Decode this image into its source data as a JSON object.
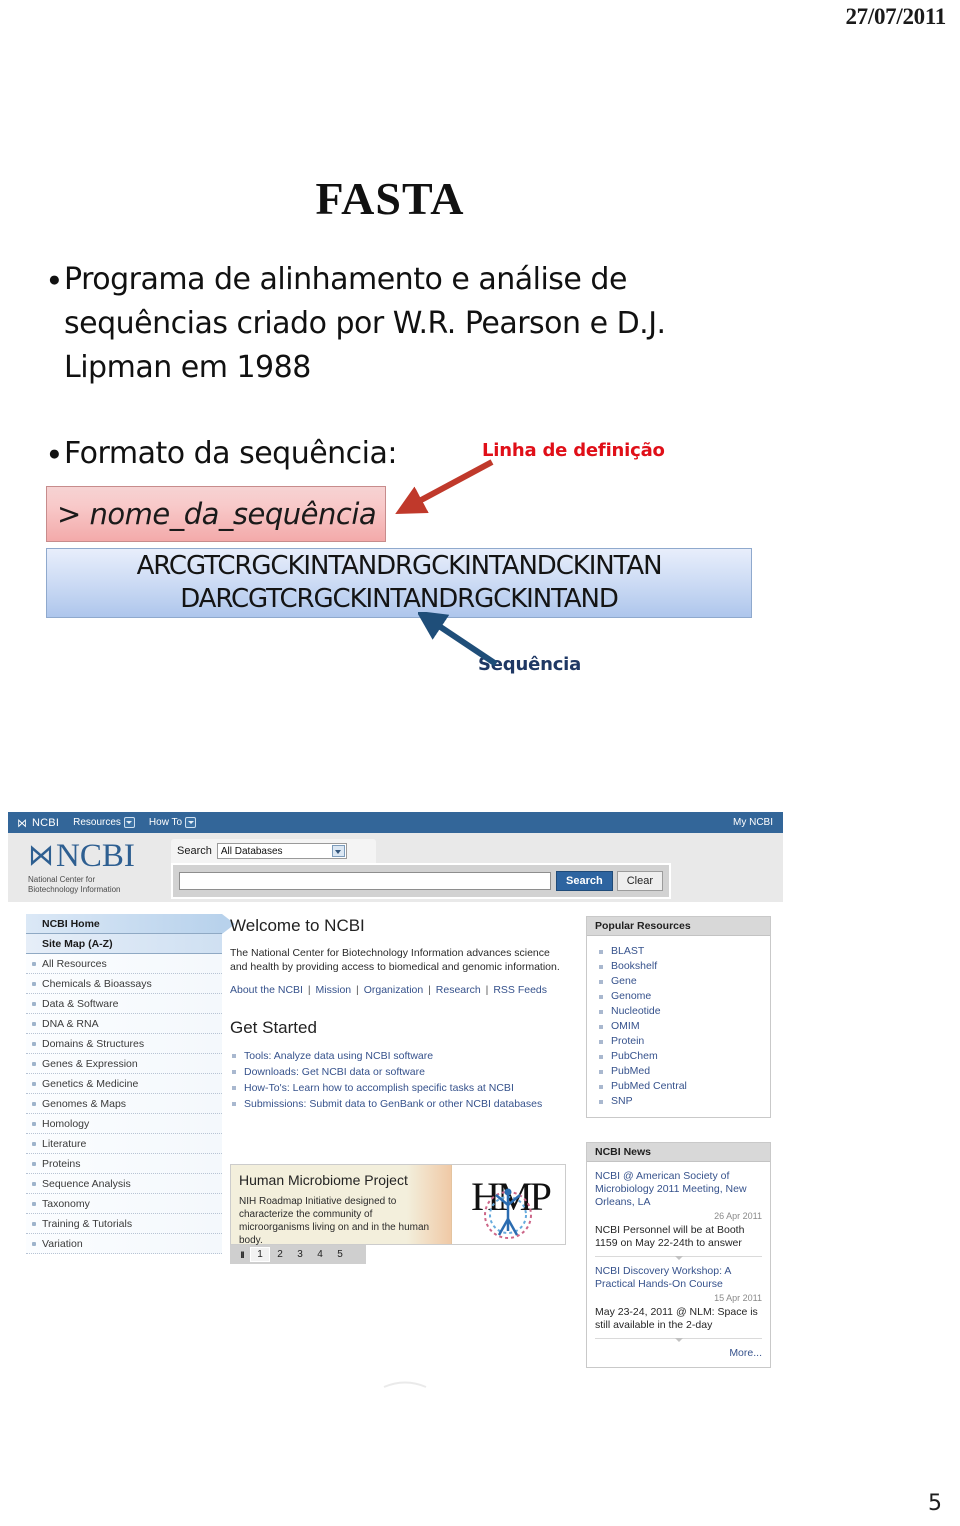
{
  "slide": {
    "date": "27/07/2011",
    "title": "FASTA",
    "number": "5",
    "bullets": [
      "Programa de alinhamento e análise de sequências criado por W.R. Pearson e D.J. Lipman em 1988",
      "Formato da sequência:"
    ]
  },
  "fasta": {
    "defline_value": "> nome_da_sequência",
    "sequence_line_1": "ARCGTCRGCKINTANDRGCKINTANDCKINTAN",
    "sequence_line_2": "DARCGTCRGCKINTANDRGCKINTAND",
    "annotation_defline": "Linha de definição",
    "annotation_sequence": "Sequência",
    "colors": {
      "defline_accent": "#e00f18",
      "sequence_accent": "#1f3864",
      "defline_box": "#f3aaaa",
      "sequence_box": "#aec6ec"
    }
  },
  "ncbi": {
    "topbar": {
      "brand": "NCBI",
      "resources": "Resources",
      "how_to": "How To",
      "my_ncbi": "My NCBI"
    },
    "brand": {
      "name": "NCBI",
      "tagline_line1": "National Center for",
      "tagline_line2": "Biotechnology Information"
    },
    "search": {
      "label": "Search",
      "database_selected": "All Databases",
      "query_value": "",
      "search_button": "Search",
      "clear_button": "Clear"
    },
    "sidebar": [
      {
        "label": "NCBI Home",
        "head": true,
        "active": true
      },
      {
        "label": "Site Map (A-Z)",
        "head": true,
        "active": false
      },
      {
        "label": "All Resources",
        "head": false,
        "active": false
      },
      {
        "label": "Chemicals & Bioassays",
        "head": false,
        "active": false
      },
      {
        "label": "Data & Software",
        "head": false,
        "active": false
      },
      {
        "label": "DNA & RNA",
        "head": false,
        "active": false
      },
      {
        "label": "Domains & Structures",
        "head": false,
        "active": false
      },
      {
        "label": "Genes & Expression",
        "head": false,
        "active": false
      },
      {
        "label": "Genetics & Medicine",
        "head": false,
        "active": false
      },
      {
        "label": "Genomes & Maps",
        "head": false,
        "active": false
      },
      {
        "label": "Homology",
        "head": false,
        "active": false
      },
      {
        "label": "Literature",
        "head": false,
        "active": false
      },
      {
        "label": "Proteins",
        "head": false,
        "active": false
      },
      {
        "label": "Sequence Analysis",
        "head": false,
        "active": false
      },
      {
        "label": "Taxonomy",
        "head": false,
        "active": false
      },
      {
        "label": "Training & Tutorials",
        "head": false,
        "active": false
      },
      {
        "label": "Variation",
        "head": false,
        "active": false
      }
    ],
    "main": {
      "welcome_heading": "Welcome to NCBI",
      "welcome_paragraph": "The National Center for Biotechnology Information advances science and health by providing access to biomedical and genomic information.",
      "inline_links": [
        "About the NCBI",
        "Mission",
        "Organization",
        "Research",
        "RSS Feeds"
      ],
      "get_started_heading": "Get Started",
      "get_started_items": [
        "Tools: Analyze data using NCBI software",
        "Downloads: Get NCBI data or software",
        "How-To's: Learn how to accomplish specific tasks at NCBI",
        "Submissions: Submit data to GenBank or other NCBI databases"
      ]
    },
    "popular_resources": {
      "title": "Popular Resources",
      "items": [
        "BLAST",
        "Bookshelf",
        "Gene",
        "Genome",
        "Nucleotide",
        "OMIM",
        "Protein",
        "PubChem",
        "PubMed",
        "PubMed Central",
        "SNP"
      ]
    },
    "news": {
      "title": "NCBI News",
      "items": [
        {
          "headline": "NCBI @ American Society of Microbiology 2011 Meeting, New Orleans, LA",
          "date": "26 Apr 2011",
          "body": "NCBI Personnel will be at Booth 1159 on May 22-24th to answer"
        },
        {
          "headline": "NCBI Discovery Workshop: A Practical Hands-On Course",
          "date": "15 Apr 2011",
          "body": "May 23-24, 2011 @ NLM: Space is still available in the 2-day"
        }
      ],
      "more_label": "More..."
    },
    "carousel": {
      "title": "Human Microbiome Project",
      "description": "NIH Roadmap Initiative designed to characterize the community of microorganisms living on and in the human body.",
      "logo_text": "HMP",
      "pause_label": "II",
      "pages": [
        "1",
        "2",
        "3",
        "4",
        "5"
      ],
      "active_page": "1"
    }
  }
}
